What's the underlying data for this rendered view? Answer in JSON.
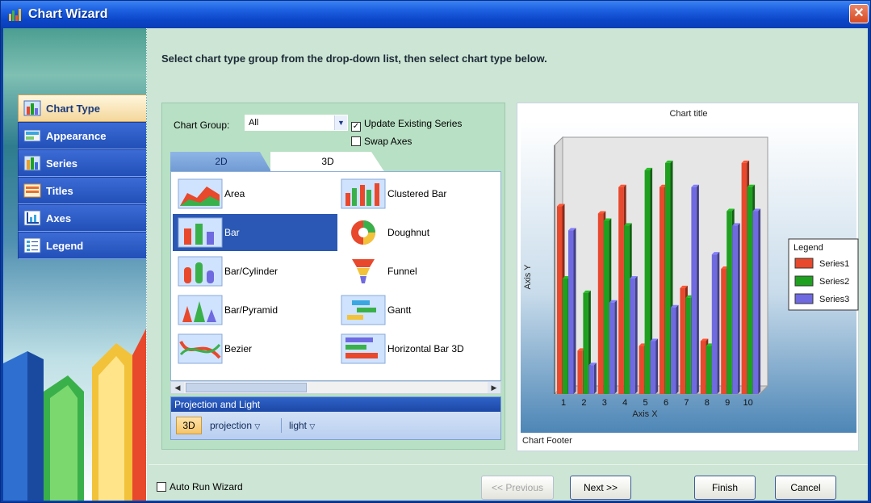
{
  "window": {
    "title": "Chart Wizard",
    "close_symbol": "✕"
  },
  "instruction": "Select chart type group from the drop-down list, then select chart type below.",
  "sidebar": {
    "items": [
      {
        "label": "Chart Type",
        "icon": "chart-type-icon",
        "active": true
      },
      {
        "label": "Appearance",
        "icon": "appearance-icon",
        "active": false
      },
      {
        "label": "Series",
        "icon": "series-icon",
        "active": false
      },
      {
        "label": "Titles",
        "icon": "titles-icon",
        "active": false
      },
      {
        "label": "Axes",
        "icon": "axes-icon",
        "active": false
      },
      {
        "label": "Legend",
        "icon": "legend-icon",
        "active": false
      }
    ]
  },
  "chart_group": {
    "label": "Chart Group:",
    "value": "All",
    "update_existing_series": {
      "label": "Update Existing Series",
      "checked": true
    },
    "swap_axes": {
      "label": "Swap Axes",
      "checked": false
    }
  },
  "tabs": [
    {
      "label": "2D",
      "active": false
    },
    {
      "label": "3D",
      "active": true
    }
  ],
  "gallery": {
    "items": [
      {
        "label": "Area",
        "icon": "area-chart-icon"
      },
      {
        "label": "Clustered Bar",
        "icon": "clustered-bar-icon"
      },
      {
        "label": "Bar",
        "icon": "bar-chart-icon",
        "selected": true
      },
      {
        "label": "Doughnut",
        "icon": "doughnut-icon"
      },
      {
        "label": "Bar/Cylinder",
        "icon": "cylinder-icon"
      },
      {
        "label": "Funnel",
        "icon": "funnel-icon"
      },
      {
        "label": "Bar/Pyramid",
        "icon": "pyramid-icon"
      },
      {
        "label": "Gantt",
        "icon": "gantt-icon"
      },
      {
        "label": "Bezier",
        "icon": "bezier-icon"
      },
      {
        "label": "Horizontal Bar 3D",
        "icon": "horizontal-bar-icon"
      }
    ]
  },
  "projection_light": {
    "header": "Projection and Light",
    "mode": "3D",
    "projection_label": "projection",
    "light_label": "light"
  },
  "chart_data": {
    "type": "bar",
    "title": "Chart title",
    "footer": "Chart Footer",
    "xlabel": "Axis X",
    "ylabel": "Axis Y",
    "categories": [
      "1",
      "2",
      "3",
      "4",
      "5",
      "6",
      "7",
      "8",
      "9",
      "10"
    ],
    "series": [
      {
        "name": "Series1",
        "color": "#e8482c",
        "values": [
          78,
          18,
          75,
          86,
          20,
          86,
          44,
          22,
          52,
          96
        ]
      },
      {
        "name": "Series2",
        "color": "#1fa01f",
        "values": [
          48,
          42,
          72,
          70,
          93,
          96,
          40,
          20,
          76,
          86
        ]
      },
      {
        "name": "Series3",
        "color": "#6f6ae0",
        "values": [
          68,
          12,
          38,
          48,
          22,
          36,
          86,
          58,
          70,
          76
        ]
      }
    ],
    "legend": {
      "title": "Legend",
      "position": "right"
    }
  },
  "footer": {
    "auto_run_label": "Auto Run Wizard",
    "auto_run_checked": false,
    "previous_label": "<< Previous",
    "next_label": "Next >>",
    "finish_label": "Finish",
    "cancel_label": "Cancel"
  }
}
